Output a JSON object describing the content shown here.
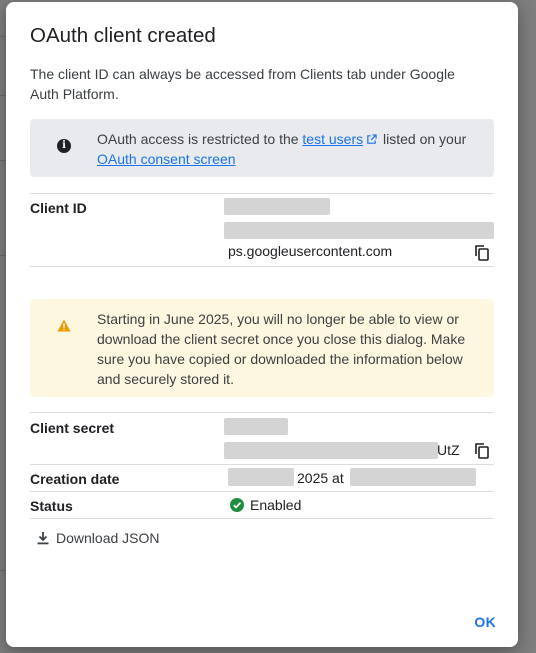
{
  "dialog": {
    "title": "OAuth client created",
    "intro": "The client ID can always be accessed from Clients tab under Google Auth Platform.",
    "info": {
      "icon": "info-icon",
      "prefix": "OAuth access is restricted to the ",
      "test_users_link": "test users",
      "middle": " listed on your ",
      "consent_link": "OAuth consent screen"
    },
    "client_id": {
      "label": "Client ID",
      "suffix": "ps.googleusercontent.com"
    },
    "warning": {
      "icon": "warning-icon",
      "text": "Starting in June 2025, you will no longer be able to view or download the client secret once you close this dialog. Make sure you have copied or downloaded the information below and securely stored it."
    },
    "client_secret": {
      "label": "Client secret",
      "suffix": "UtZ"
    },
    "creation_date": {
      "label": "Creation date",
      "year_text": "2025 at"
    },
    "status": {
      "label": "Status",
      "value": "Enabled"
    },
    "download_label": "Download JSON",
    "ok_label": "OK"
  },
  "colors": {
    "link": "#1a73e8",
    "info_bg": "#e8eaed",
    "warning_bg": "#fef7e0",
    "warning_icon": "#f29900",
    "enabled": "#1e8e3e"
  }
}
